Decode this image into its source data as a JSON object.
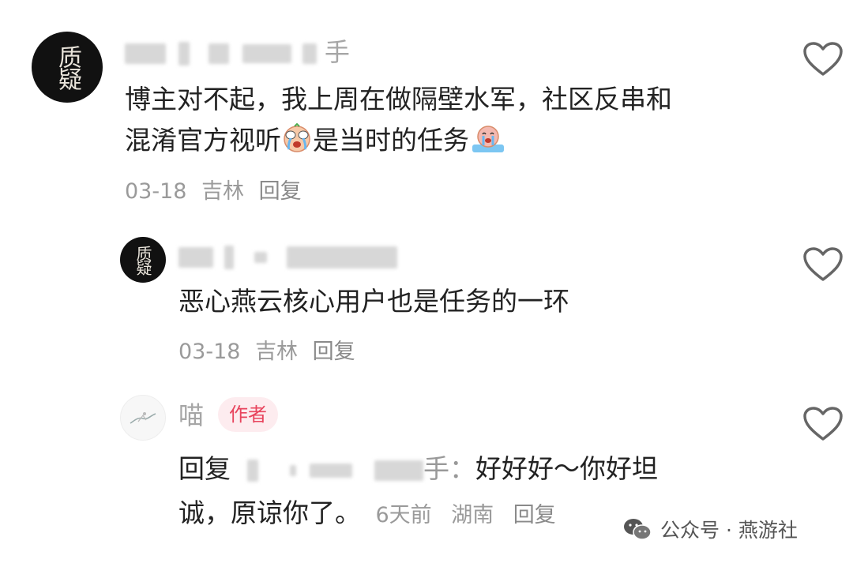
{
  "comments": [
    {
      "avatar_text": "质疑",
      "name_visible_suffix": "手",
      "text_line1": "博主对不起，我上周在做隔壁水军，社区反串和",
      "text_line2_a": "混淆官方视听",
      "text_line2_b": "是当时的任务",
      "date": "03-18",
      "location": "吉林",
      "reply_label": "回复"
    },
    {
      "avatar_text": "质疑",
      "text": "恶心燕云核心用户也是任务的一环",
      "date": "03-18",
      "location": "吉林",
      "reply_label": "回复"
    },
    {
      "name": "喵",
      "badge": "作者",
      "reply_prefix": "回复",
      "reply_target_suffix": "手：",
      "text_line1_rest": "好好好～你好坦",
      "text_line2": "诚，原谅你了。",
      "time": "6天前",
      "location": "湖南",
      "reply_label": "回复"
    }
  ],
  "footer": {
    "source": "公众号 · 燕游社"
  },
  "icons": {
    "like": "heart-outline-icon",
    "emoji_cry": "crying-face-emoji",
    "emoji_tears": "crying-tears-emoji",
    "wechat": "wechat-logo-icon"
  },
  "colors": {
    "badge_bg": "#fdecef",
    "badge_text": "#e8445d",
    "meta": "#9a9a9a"
  }
}
